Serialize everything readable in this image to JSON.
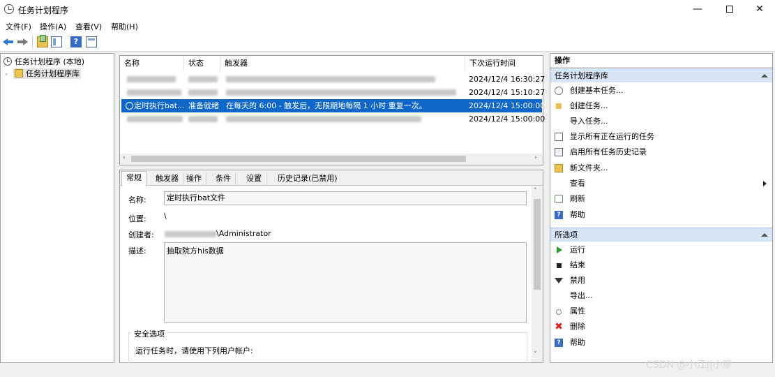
{
  "window": {
    "title": "任务计划程序",
    "min_glyph": "—",
    "close_glyph": "✕"
  },
  "menu": [
    "文件(F)",
    "操作(A)",
    "查看(V)",
    "帮助(H)"
  ],
  "toolbar": {
    "icons": [
      "back-arrow-icon",
      "forward-arrow-icon",
      "folder-up-icon",
      "show-hide-console-tree-icon",
      "help-icon",
      "show-hide-action-pane-icon"
    ],
    "help_glyph": "?"
  },
  "tree": {
    "root": "任务计划程序 (本地)",
    "child": "任务计划程序库",
    "expand_glyph": "›"
  },
  "tasklist": {
    "columns": [
      "名称",
      "状态",
      "触发器",
      "下次运行时间"
    ],
    "rows": [
      {
        "name": "",
        "status": "",
        "trigger": "",
        "next_run": "2024/12/4 16:30:27",
        "selected": false
      },
      {
        "name": "",
        "status": "",
        "trigger": "",
        "next_run": "2024/12/4 15:10:27",
        "selected": false
      },
      {
        "name": "定时执行bat...",
        "status": "准备就绪",
        "trigger": "在每天的 6:00 - 触发后，无限期地每隔 1 小时 重复一次。",
        "next_run": "2024/12/4 15:00:00",
        "selected": true
      },
      {
        "name": "",
        "status": "",
        "trigger": "",
        "next_run": "2024/12/4 15:00:00",
        "selected": false
      }
    ],
    "scroll_left": "‹",
    "scroll_right": "›"
  },
  "details": {
    "tabs": [
      "常规",
      "触发器",
      "操作",
      "条件",
      "设置",
      "历史记录(已禁用)"
    ],
    "name_label": "名称:",
    "name_value": "定时执行bat文件",
    "location_label": "位置:",
    "location_value": "\\",
    "author_label": "创建者:",
    "author_value": "\\Administrator",
    "desc_label": "描述:",
    "desc_value": "抽取院方his数据",
    "security_title": "安全选项",
    "security_text": "运行任务时，请使用下列用户帐户:",
    "scroll_up": "˄",
    "scroll_down": "˅"
  },
  "actions": {
    "header": "操作",
    "section1": "任务计划程序库",
    "items1": [
      {
        "label": "创建基本任务...",
        "icon": "clock-book-icon"
      },
      {
        "label": "创建任务...",
        "icon": "new-task-icon"
      },
      {
        "label": "导入任务...",
        "icon": "import-icon"
      },
      {
        "label": "显示所有正在运行的任务",
        "icon": "running-tasks-icon"
      },
      {
        "label": "启用所有任务历史记录",
        "icon": "history-icon"
      },
      {
        "label": "新文件夹...",
        "icon": "new-folder-icon"
      },
      {
        "label": "查看",
        "icon": "view-icon"
      },
      {
        "label": "刷新",
        "icon": "refresh-icon"
      },
      {
        "label": "帮助",
        "icon": "help-icon"
      }
    ],
    "section2": "所选项",
    "items2": [
      {
        "label": "运行",
        "icon": "run-icon"
      },
      {
        "label": "结束",
        "icon": "end-icon"
      },
      {
        "label": "禁用",
        "icon": "disable-icon"
      },
      {
        "label": "导出...",
        "icon": "export-icon"
      },
      {
        "label": "属性",
        "icon": "properties-icon"
      },
      {
        "label": "删除",
        "icon": "delete-icon"
      },
      {
        "label": "帮助",
        "icon": "help-icon"
      }
    ],
    "help_glyph": "?",
    "delete_glyph": "✖"
  },
  "watermark": "CSDN @小江||小廖"
}
